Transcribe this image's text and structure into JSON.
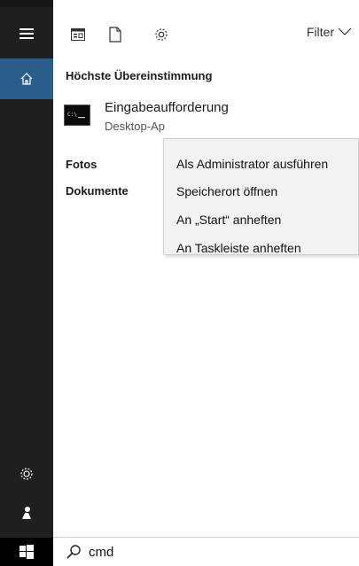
{
  "toolbar": {
    "filter_label": "Filter"
  },
  "results": {
    "best_match_heading": "Höchste Übereinstimmung",
    "best_match": {
      "title": "Eingabeaufforderung",
      "subtitle": "Desktop-Ap"
    },
    "categories": [
      "Fotos",
      "Dokumente"
    ]
  },
  "context_menu": {
    "items": [
      "Als Administrator ausführen",
      "Speicherort öffnen",
      "An „Start“ anheften",
      "An Taskleiste anheften"
    ]
  },
  "search": {
    "query": "cmd"
  },
  "icons": {
    "menu": "hamburger-icon",
    "home": "home-icon",
    "apps": "apps-icon",
    "documents": "document-icon",
    "settings": "gear-icon",
    "filter": "chevron-down-icon",
    "user": "user-icon",
    "windows": "windows-logo-icon",
    "search": "search-icon"
  },
  "colors": {
    "rail": "#1f1f1f",
    "rail_active": "#2b5d8c",
    "menu_bg": "#f2f2f2"
  }
}
